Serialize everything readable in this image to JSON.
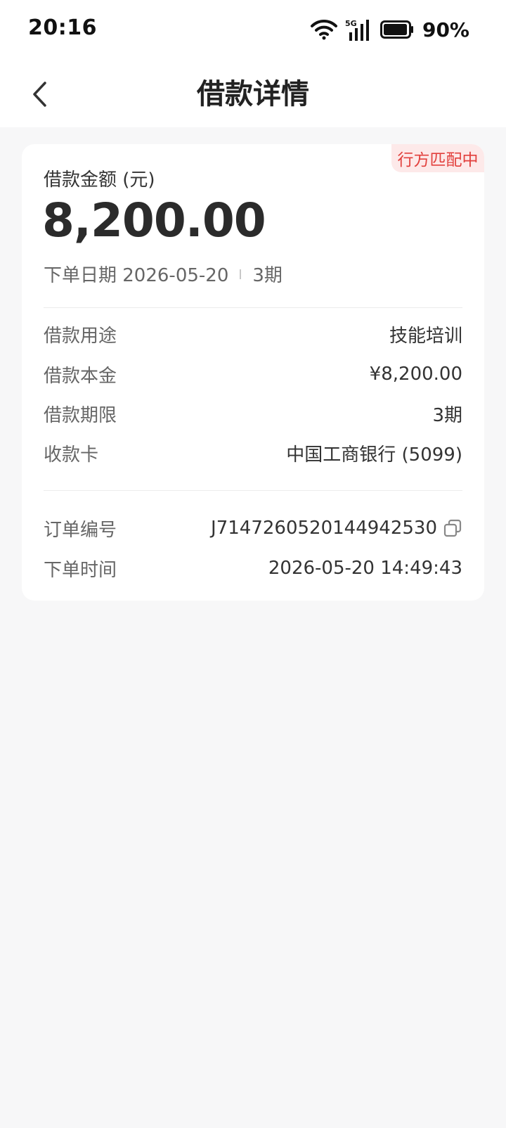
{
  "status_bar": {
    "time": "20:16",
    "network": "5G",
    "battery_percent": "90%",
    "icons": [
      "wifi-icon",
      "signal-icon",
      "battery-icon"
    ]
  },
  "header": {
    "title": "借款详情",
    "back_icon": "chevron-left-icon"
  },
  "loan": {
    "status_badge": "行方匹配中",
    "amount_label": "借款金额 (元)",
    "amount_value": "8,200.00",
    "order_date": "下单日期 2026-05-20",
    "term_short": "3期",
    "details": [
      {
        "label": "借款用途",
        "value": "技能培训"
      },
      {
        "label": "借款本金",
        "value": "¥8,200.00"
      },
      {
        "label": "借款期限",
        "value": "3期"
      },
      {
        "label": "收款卡",
        "value": "中国工商银行 (5099)"
      }
    ],
    "order": [
      {
        "label": "订单编号",
        "value": "J7147260520144942530"
      },
      {
        "label": "下单时间",
        "value": "2026-05-20 14:49:43"
      }
    ]
  },
  "colors": {
    "badge_bg": "#fde9e9",
    "badge_text": "#e2403d",
    "page_bg": "#f7f7f8",
    "card_bg": "#ffffff"
  }
}
